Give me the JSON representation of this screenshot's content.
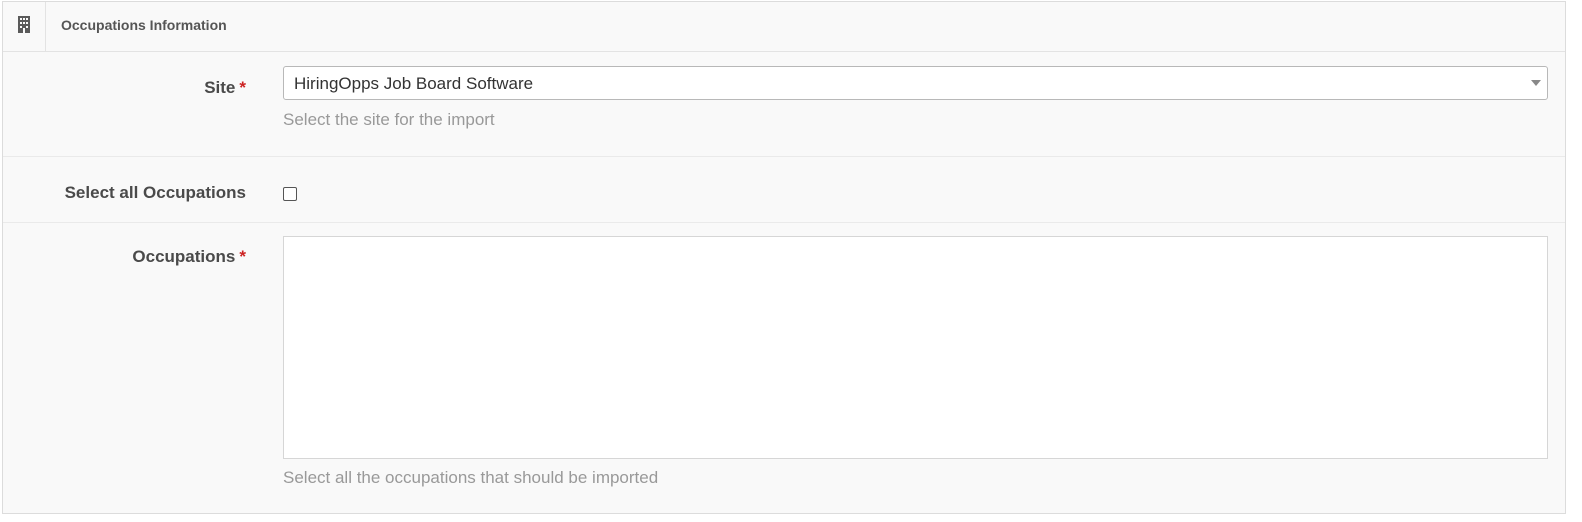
{
  "header": {
    "title": "Occupations Information",
    "icon": "building-icon"
  },
  "form": {
    "site": {
      "label": "Site",
      "required_mark": "*",
      "value": "HiringOpps Job Board Software",
      "help": "Select the site for the import"
    },
    "select_all": {
      "label": "Select all Occupations",
      "checked": false
    },
    "occupations": {
      "label": "Occupations",
      "required_mark": "*",
      "options": [],
      "help": "Select all the occupations that should be imported"
    }
  },
  "colors": {
    "required": "#cc2222",
    "help_text": "#999999",
    "panel_bg": "#f9f9f9"
  }
}
